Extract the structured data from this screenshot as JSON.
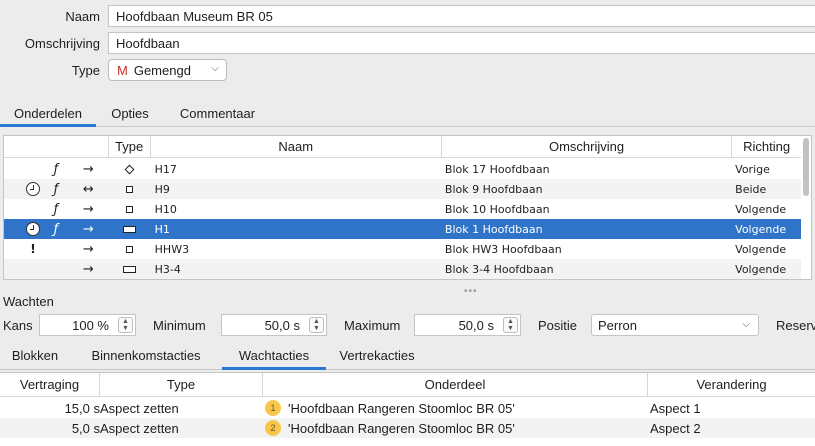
{
  "form": {
    "naam_label": "Naam",
    "naam_value": "Hoofdbaan Museum BR 05",
    "omschrijving_label": "Omschrijving",
    "omschrijving_value": "Hoofdbaan",
    "type_label": "Type",
    "type_icon": "M",
    "type_value": "Gemengd"
  },
  "tabs": [
    {
      "label": "Onderdelen",
      "active": true
    },
    {
      "label": "Opties",
      "active": false
    },
    {
      "label": "Commentaar",
      "active": false
    }
  ],
  "table": {
    "headers": {
      "type": "Type",
      "naam": "Naam",
      "omschrijving": "Omschrijving",
      "richting": "Richting"
    },
    "rows": [
      {
        "clock": false,
        "excl": "",
        "f": "ƒ",
        "arrow": "→",
        "shape": "diamond",
        "naam": "H17",
        "omschrijving": "Blok 17 Hoofdbaan",
        "richting": "Vorige"
      },
      {
        "clock": true,
        "excl": "",
        "f": "ƒ",
        "arrow": "↔",
        "shape": "square",
        "naam": "H9",
        "omschrijving": "Blok 9 Hoofdbaan",
        "richting": "Beide"
      },
      {
        "clock": false,
        "excl": "",
        "f": "ƒ",
        "arrow": "→",
        "shape": "square",
        "naam": "H10",
        "omschrijving": "Blok 10 Hoofdbaan",
        "richting": "Volgende"
      },
      {
        "clock": true,
        "excl": "",
        "f": "ƒ",
        "arrow": "→",
        "shape": "rect",
        "naam": "H1",
        "omschrijving": "Blok 1 Hoofdbaan",
        "richting": "Volgende",
        "selected": true
      },
      {
        "clock": false,
        "excl": "!",
        "f": "",
        "arrow": "→",
        "shape": "square",
        "naam": "HHW3",
        "omschrijving": "Blok HW3 Hoofdbaan",
        "richting": "Volgende"
      },
      {
        "clock": false,
        "excl": "",
        "f": "",
        "arrow": "→",
        "shape": "rect",
        "naam": "H3-4",
        "omschrijving": "Blok 3-4 Hoofdbaan",
        "richting": "Volgende"
      }
    ]
  },
  "wachten": {
    "title": "Wachten",
    "kans_label": "Kans",
    "kans_value": "100 %",
    "minimum_label": "Minimum",
    "minimum_value": "50,0 s",
    "maximum_label": "Maximum",
    "maximum_value": "50,0 s",
    "positie_label": "Positie",
    "positie_value": "Perron",
    "reserv_label": "Reserv"
  },
  "subtabs": [
    {
      "label": "Blokken",
      "active": false
    },
    {
      "label": "Binnenkomstacties",
      "active": false
    },
    {
      "label": "Wachtacties",
      "active": true
    },
    {
      "label": "Vertrekacties",
      "active": false
    }
  ],
  "actions": {
    "headers": {
      "vertraging": "Vertraging",
      "type": "Type",
      "onderdeel": "Onderdeel",
      "verandering": "Verandering"
    },
    "rows": [
      {
        "vertraging": "15,0 s",
        "type": "Aspect zetten",
        "badge": "1",
        "onderdeel": "'Hoofdbaan Rangeren Stoomloc BR 05'",
        "verandering": "Aspect 1"
      },
      {
        "vertraging": "5,0 s",
        "type": "Aspect zetten",
        "badge": "2",
        "onderdeel": "'Hoofdbaan Rangeren Stoomloc BR 05'",
        "verandering": "Aspect 2"
      }
    ]
  },
  "colors": {
    "accent": "#2a79d0",
    "selection": "#2f74c9",
    "badge": "#f8c64a",
    "type_icon": "#c8302c"
  }
}
